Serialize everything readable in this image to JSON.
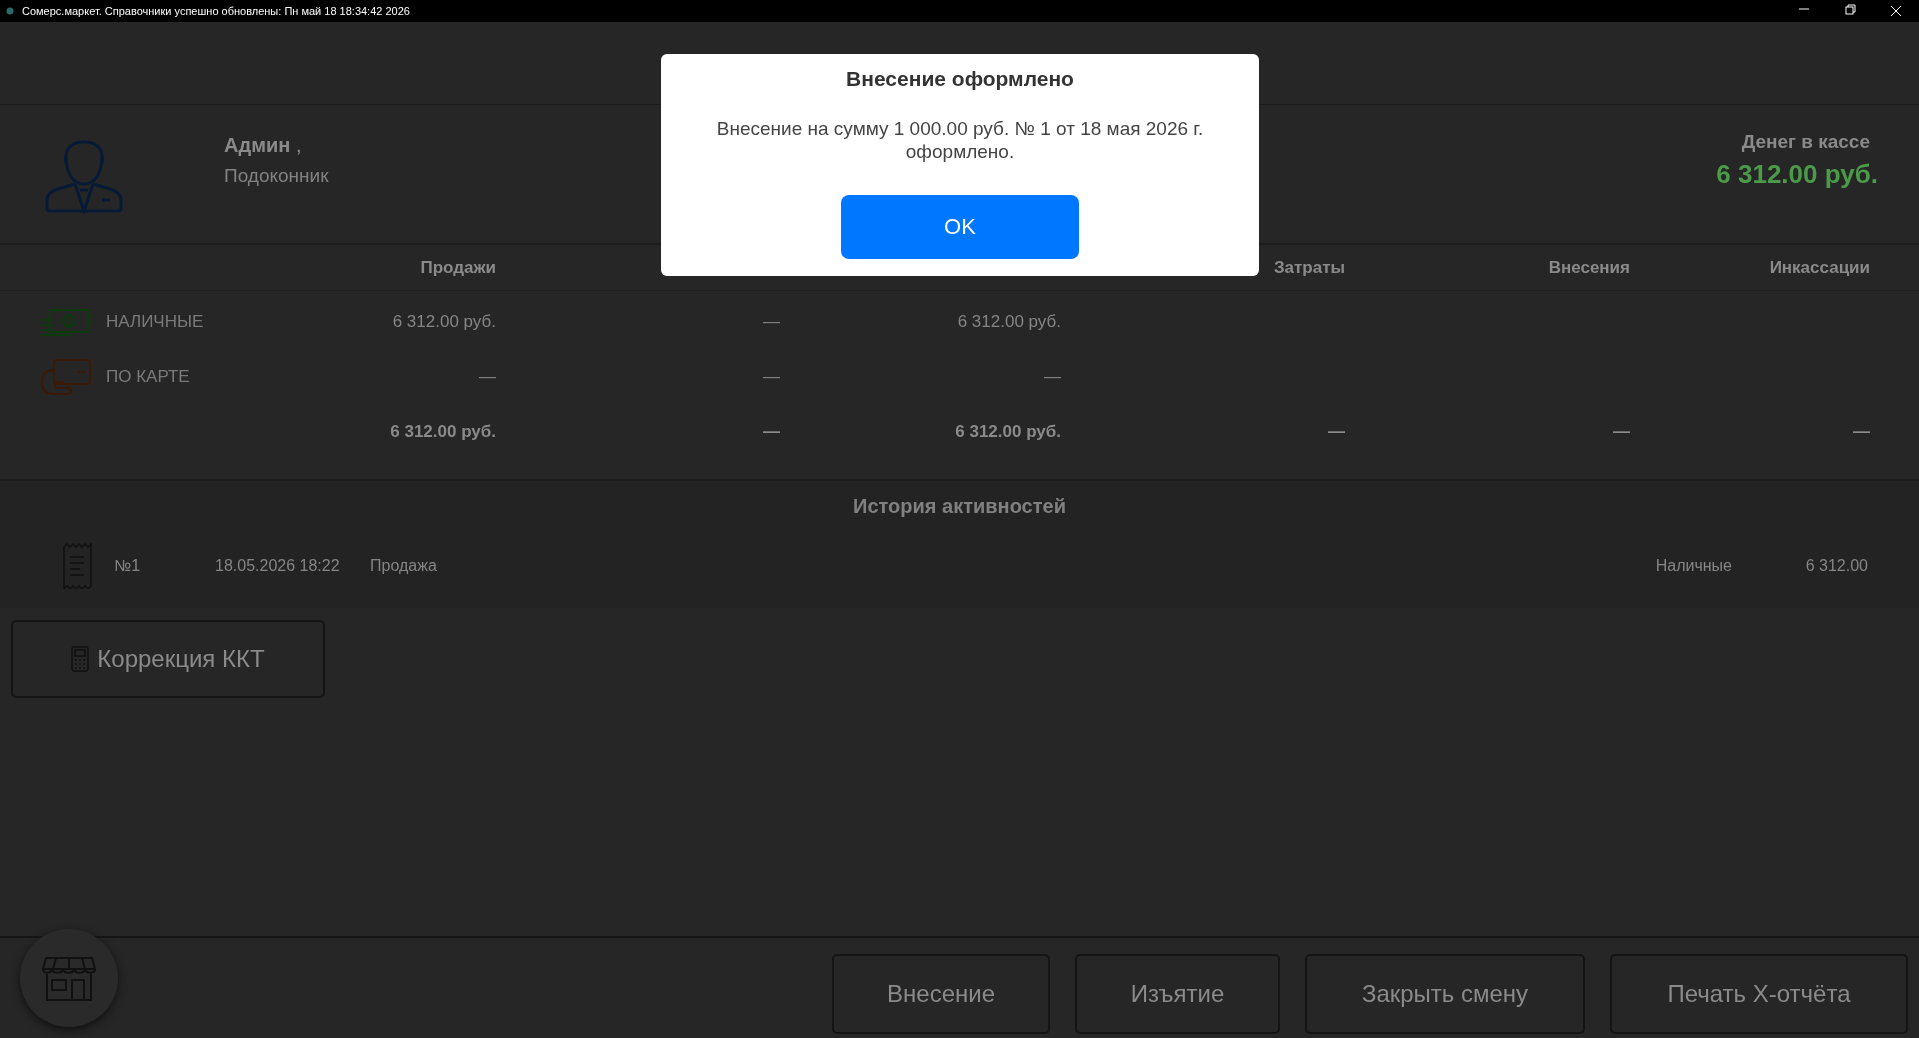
{
  "title_bar": {
    "text": "Сомерс.маркет. Справочники успешно обновлены: Пн май 18 18:34:42 2026"
  },
  "user": {
    "name": "Админ",
    "suffix": ",",
    "location": "Подоконник"
  },
  "cash": {
    "label": "Денег в кассе",
    "amount": "6 312.00 руб."
  },
  "table": {
    "columns": [
      "Продажи",
      null,
      null,
      "Затраты",
      "Внесения",
      "Инкассации"
    ],
    "rows": [
      {
        "kind": "cash",
        "label": "НАЛИЧНЫЕ",
        "cells": [
          "6 312.00 руб.",
          "—",
          "6 312.00 руб.",
          null,
          null,
          null
        ]
      },
      {
        "kind": "card",
        "label": "ПО КАРТЕ",
        "cells": [
          "—",
          "—",
          "—",
          null,
          null,
          null
        ]
      },
      {
        "kind": "total",
        "cells": [
          "6 312.00 руб.",
          "—",
          "6 312.00 руб.",
          "—",
          "—",
          "—"
        ]
      }
    ]
  },
  "history": {
    "title": "История активностей",
    "items": [
      {
        "number": "№1",
        "datetime": "18.05.2026 18:22",
        "type": "Продажа",
        "payment": "Наличные",
        "amount": "6 312.00"
      }
    ]
  },
  "correction_button": "Коррекция ККТ",
  "actions": [
    "Внесение",
    "Изъятие",
    "Закрыть смену",
    "Печать X-отчёта"
  ],
  "dialog": {
    "title": "Внесение оформлено",
    "message": "Внесение на сумму 1 000.00 руб. № 1 от 18 мая 2026 г. оформлено.",
    "button": "OK"
  }
}
